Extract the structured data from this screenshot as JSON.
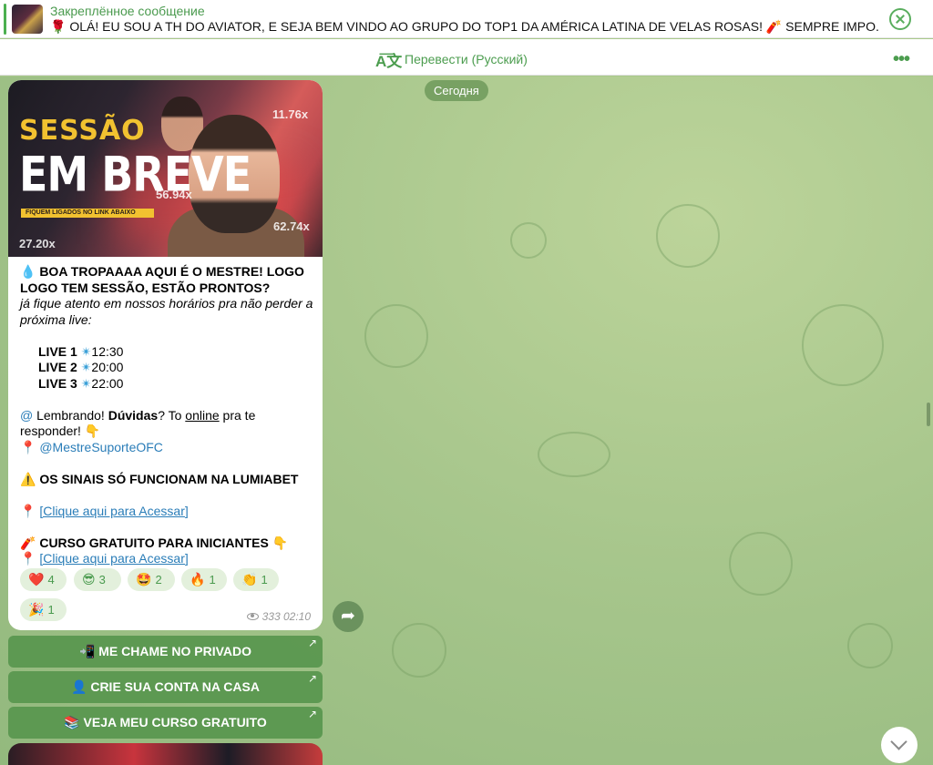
{
  "pinned": {
    "title": "Закреплённое сообщение",
    "text": "🌹 OLÁ! EU SOU A TH DO AVIATOR, E SEJA BEM VINDO AO GRUPO DO TOP1 DA AMÉRICA LATINA DE VELAS ROSAS! 🧨 SEMPRE IMPO...",
    "accent_color": "#4caf50"
  },
  "translate": {
    "label": "Перевести (Русский)"
  },
  "chat": {
    "date": "Сегодня",
    "message": {
      "banner": {
        "title_top": "SESSÃO",
        "title_bottom": "EM BREVE",
        "strip": "FIQUEM LIGADOS NO LINK ABAIXO",
        "multipliers": [
          "11.76x",
          "56.94x",
          "62.74x",
          "27.20x"
        ]
      },
      "headline": "💧 BOA TROPAAAA AQUI É O MESTRE! LOGO LOGO TEM SESSÃO, ESTÃO PRONTOS?",
      "subline": "já fique atento em nossos horários pra não perder a próxima live:",
      "lives": [
        {
          "label": "LIVE 1",
          "time": "12:30"
        },
        {
          "label": "LIVE 2",
          "time": "20:00"
        },
        {
          "label": "LIVE 3",
          "time": "22:00"
        }
      ],
      "reminder_prefix": "Lembrando! ",
      "reminder_bold": "Dúvidas",
      "reminder_mid": "? To ",
      "reminder_link": "online",
      "reminder_suffix": " pra te responder! 👇",
      "support_handle": "@MestreSuporteOFC",
      "signals_text": "OS SINAIS SÓ FUNCIONAM NA LUMIABET",
      "signals_link": "[Clique aqui para Acessar]",
      "course_text": "CURSO GRATUITO PARA INICIANTES 👇",
      "course_link": "[Clique aqui para Acessar]",
      "reactions": [
        {
          "emoji": "❤️",
          "count": "4"
        },
        {
          "emoji": "😎",
          "count": "3"
        },
        {
          "emoji": "🤩",
          "count": "2"
        },
        {
          "emoji": "🔥",
          "count": "1"
        },
        {
          "emoji": "👏",
          "count": "1"
        },
        {
          "emoji": "🎉",
          "count": "1"
        }
      ],
      "views": "333",
      "time": "02:10"
    },
    "buttons": [
      {
        "label": "📲 ME CHAME NO PRIVADO"
      },
      {
        "label": "👤 CRIE SUA CONTA NA CASA"
      },
      {
        "label": "📚 VEJA MEU CURSO GRATUITO"
      }
    ]
  }
}
